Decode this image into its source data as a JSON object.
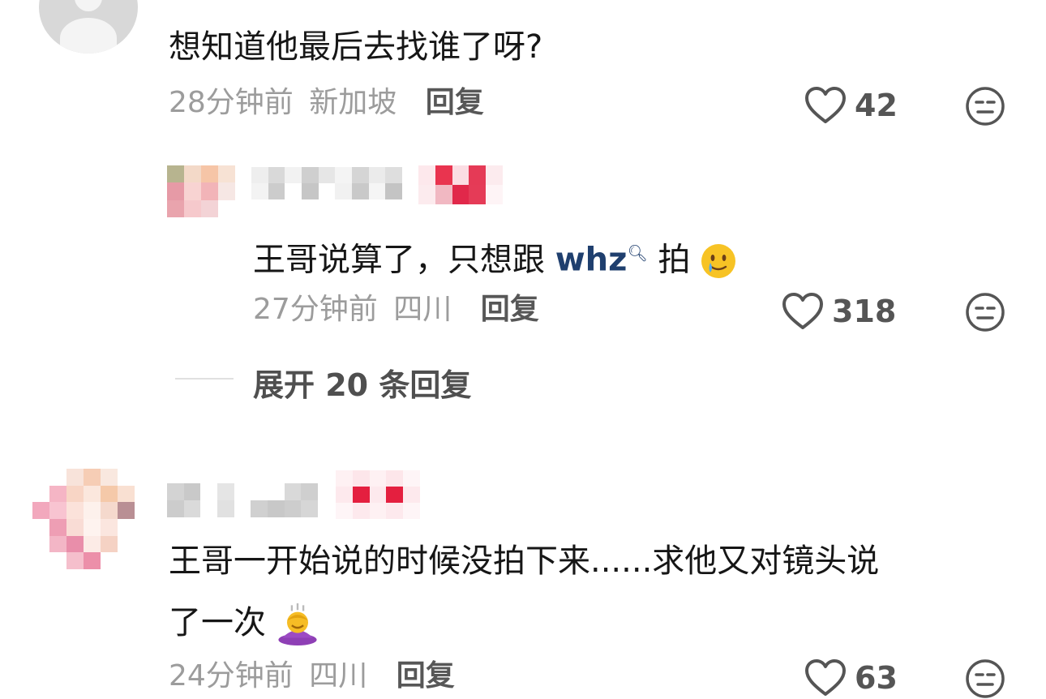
{
  "comment1": {
    "text": "想知道他最后去找谁了呀?",
    "time": "28分钟前",
    "location": "新加坡",
    "reply_label": "回复",
    "likes": "42"
  },
  "reply1": {
    "text_before": "王哥说算了，只想跟 ",
    "link": "whz",
    "text_after": " 拍",
    "emoji": "crying-smile-emoji",
    "time": "27分钟前",
    "location": "四川",
    "reply_label": "回复",
    "likes": "318"
  },
  "expand": {
    "label": "展开 20 条回复"
  },
  "comment2": {
    "text_line1": "王哥一开始说的时候没拍下来......求他又对镜头说",
    "text_line2": "了一次",
    "emoji": "bowing-person-emoji",
    "time": "24分钟前",
    "location": "四川",
    "reply_label": "回复",
    "likes": "63"
  },
  "colors": {
    "text": "#161616",
    "meta": "#9c9c9c",
    "link": "#1f3f6e",
    "icon": "#555555"
  }
}
